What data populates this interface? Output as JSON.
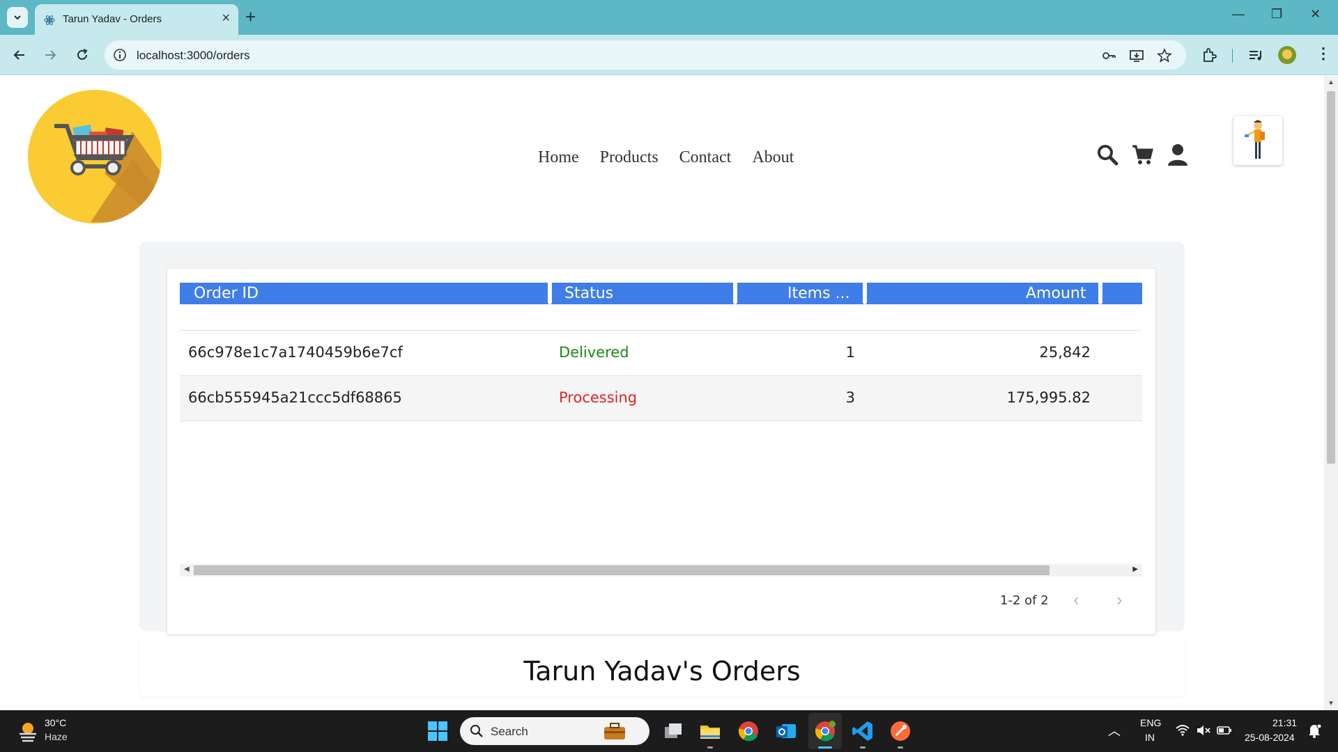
{
  "browser": {
    "tab_title": "Tarun Yadav - Orders",
    "url": "localhost:3000/orders",
    "accent_color": "#5cb8c4"
  },
  "site": {
    "nav": [
      "Home",
      "Products",
      "Contact",
      "About"
    ],
    "header_icons": [
      "search-icon",
      "cart-icon",
      "user-icon"
    ]
  },
  "orders_table": {
    "columns": [
      "Order ID",
      "Status",
      "Items ...",
      "Amount"
    ],
    "rows": [
      {
        "order_id": "66c978e1c7a1740459b6e7cf",
        "status": "Delivered",
        "status_color": "#1a8a1a",
        "items": "1",
        "amount": "25,842"
      },
      {
        "order_id": "66cb555945a21ccc5df68865",
        "status": "Processing",
        "status_color": "#e02424",
        "items": "3",
        "amount": "175,995.82"
      }
    ],
    "pagination": "1-2 of 2",
    "header_color": "#3f7ee8"
  },
  "page_title": "Tarun Yadav's Orders",
  "taskbar": {
    "weather_temp": "30°C",
    "weather_desc": "Haze",
    "search_label": "Search",
    "lang_line1": "ENG",
    "lang_line2": "IN",
    "time": "21:31",
    "date": "25-08-2024"
  }
}
